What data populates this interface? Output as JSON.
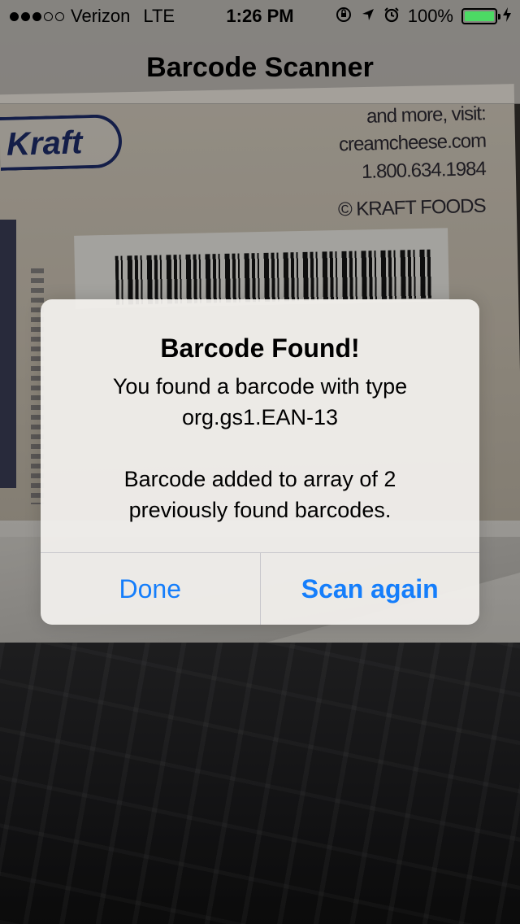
{
  "status_bar": {
    "signal_dots": [
      true,
      true,
      true,
      false,
      false
    ],
    "carrier": "Verizon",
    "network": "LTE",
    "time": "1:26 PM",
    "battery_percent": "100%",
    "battery_level": 1.0,
    "battery_color": "#4cd964",
    "icons": [
      "orientation-lock-icon",
      "location-arrow-icon",
      "alarm-icon",
      "charging-bolt-icon"
    ]
  },
  "nav_bar": {
    "title": "Barcode Scanner"
  },
  "camera_preview": {
    "box_brand": "Kraft",
    "box_text": [
      "and more, visit:",
      "creamcheese.com",
      "1.800.634.1984",
      "© KRAFT FOODS"
    ]
  },
  "alert": {
    "title": "Barcode Found!",
    "message": "You found a barcode with type\norg.gs1.EAN-13\n\nBarcode added to array of 2\npreviously found barcodes.",
    "buttons": {
      "done": "Done",
      "scan_again": "Scan again"
    },
    "accent_color": "#157efb"
  }
}
